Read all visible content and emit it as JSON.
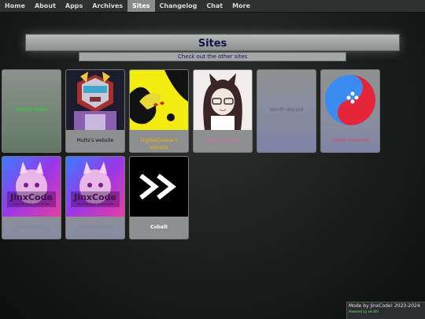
{
  "nav": {
    "items": [
      {
        "label": "Home"
      },
      {
        "label": "About"
      },
      {
        "label": "Apps"
      },
      {
        "label": "Archives"
      },
      {
        "label": "Sites"
      },
      {
        "label": "Changelog"
      },
      {
        "label": "Chat"
      },
      {
        "label": "More"
      }
    ],
    "active": "Sites"
  },
  "header": {
    "title": "Sites",
    "subtitle": "Check out the other sites"
  },
  "cards": [
    {
      "label": "Venith main",
      "label_color": "#34c34a"
    },
    {
      "label": "Mutts's website",
      "label_color": "#111111"
    },
    {
      "label": "DigitalCheese's website",
      "label_color": "#f0b400"
    },
    {
      "label": "Juliet's website",
      "label_color": "#e26aa9"
    },
    {
      "label": "Venith discord",
      "label_color": "#575c74"
    },
    {
      "label": "Venith nintendo",
      "label_color": "#e4485a"
    },
    {
      "label": "Backup Site",
      "label_color": "#7e8196"
    },
    {
      "label": "JinxCode's list",
      "label_color": "#7e8196"
    },
    {
      "label": "Cobalt",
      "label_color": "#ffffff"
    }
  ],
  "thumbs": {
    "jinxcode_logo": "JinxCode",
    "jinxcode_tagline": "Genuine Mode by JinxCode"
  },
  "footer": {
    "line1": "Mode by JinxCode! 2023-2024",
    "line2": "Powered by venith!"
  },
  "colors": {
    "accent_title": "#12124a",
    "nav_active": "#8a8c8c"
  }
}
